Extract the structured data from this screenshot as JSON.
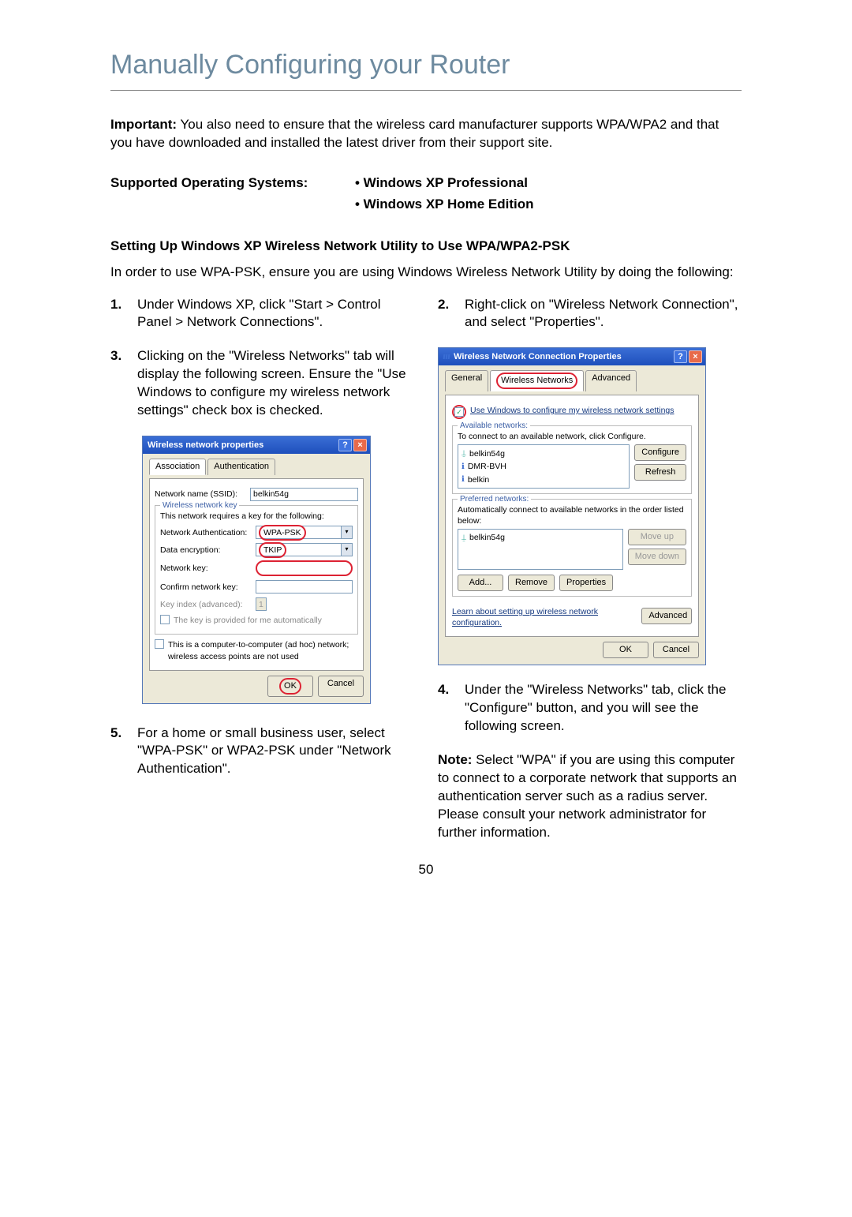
{
  "page_title": "Manually Configuring your Router",
  "important_label": "Important:",
  "important_text": " You also need to ensure that the wireless card manufacturer supports WPA/WPA2 and that you have downloaded and installed the latest driver from their support site.",
  "supported_label": "Supported Operating Systems:",
  "supported_items": [
    "• Windows XP Professional",
    "• Windows XP Home Edition"
  ],
  "subhead": "Setting Up Windows XP Wireless Network Utility to Use WPA/WPA2-PSK",
  "intro": "In order to use WPA-PSK, ensure you are using Windows Wireless Network Utility by doing the following:",
  "steps": {
    "s1": "Under Windows XP, click \"Start > Control Panel > Network Connections\".",
    "s2": "Right-click on \"Wireless Network Connection\", and select \"Properties\".",
    "s3": "Clicking on the \"Wireless Networks\" tab will display the following screen. Ensure the \"Use Windows to configure my wireless network settings\" check box is checked.",
    "s4": "Under the \"Wireless Networks\" tab, click the \"Configure\" button, and you will see the following screen.",
    "s5": "For a home or small business user, select \"WPA-PSK\" or WPA2-PSK under \"Network Authentication\"."
  },
  "note_label": "Note:",
  "note_text": " Select \"WPA\" if you are using this computer to connect to a corporate network that supports an authentication server such as a radius server. Please consult your network administrator for further information.",
  "page_number": "50",
  "dlg1": {
    "title": "Wireless network properties",
    "tabs": [
      "Association",
      "Authentication"
    ],
    "ssid_label": "Network name (SSID):",
    "ssid_value": "belkin54g",
    "group_legend": "Wireless network key",
    "group_info": "This network requires a key for the following:",
    "auth_label": "Network Authentication:",
    "auth_value": "WPA-PSK",
    "enc_label": "Data encryption:",
    "enc_value": "TKIP",
    "key_label": "Network key:",
    "confirm_label": "Confirm network key:",
    "keyindex_label": "Key index (advanced):",
    "keyindex_value": "1",
    "auto_key_label": "The key is provided for me automatically",
    "adhoc_label": "This is a computer-to-computer (ad hoc) network; wireless access points are not used",
    "ok": "OK",
    "cancel": "Cancel"
  },
  "dlg2": {
    "title": "Wireless Network Connection Properties",
    "tabs": [
      "General",
      "Wireless Networks",
      "Advanced"
    ],
    "use_windows": "Use Windows to configure my wireless network settings",
    "avail_legend": "Available networks:",
    "avail_hint": "To connect to an available network, click Configure.",
    "avail_items": [
      "belkin54g",
      "DMR-BVH",
      "belkin"
    ],
    "configure": "Configure",
    "refresh": "Refresh",
    "pref_legend": "Preferred networks:",
    "pref_hint": "Automatically connect to available networks in the order listed below:",
    "pref_items": [
      "belkin54g"
    ],
    "moveup": "Move up",
    "movedown": "Move down",
    "add": "Add...",
    "remove": "Remove",
    "properties": "Properties",
    "learn": "Learn about setting up wireless network configuration.",
    "advanced": "Advanced",
    "ok": "OK",
    "cancel": "Cancel"
  }
}
